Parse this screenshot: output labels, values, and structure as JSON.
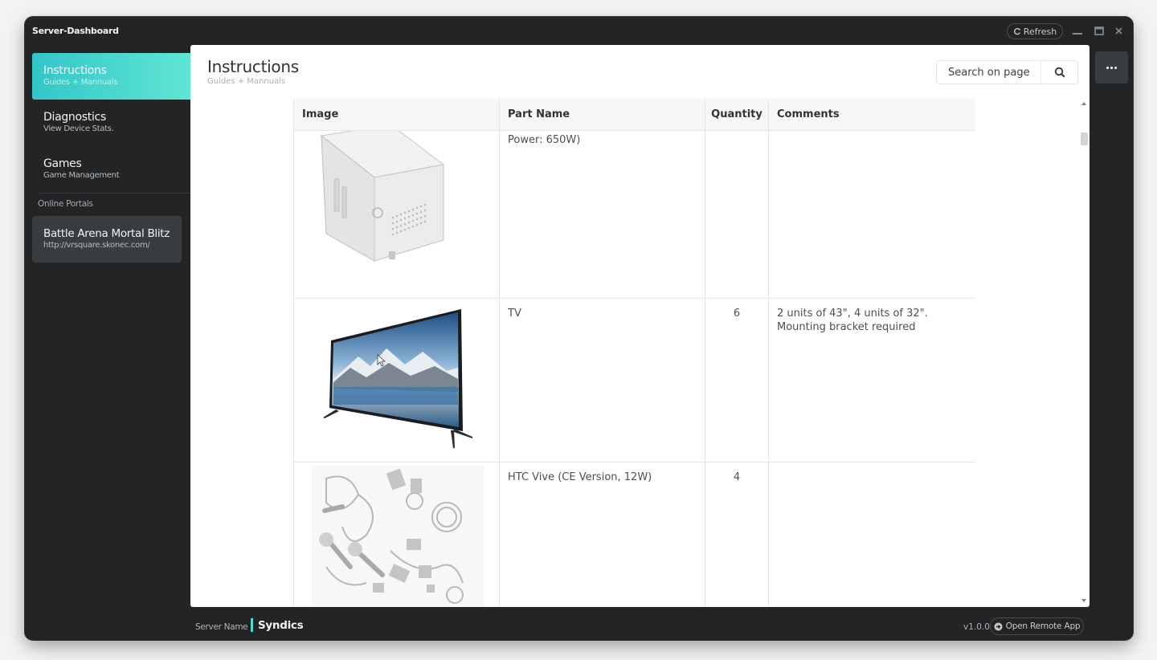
{
  "window": {
    "title": "Server-Dashboard",
    "refresh_label": "Refresh"
  },
  "sidebar": {
    "items": [
      {
        "title": "Instructions",
        "subtitle": "Guides + Mannuals"
      },
      {
        "title": "Diagnostics",
        "subtitle": "View Device Stats."
      },
      {
        "title": "Games",
        "subtitle": "Game Management"
      }
    ],
    "section_label": "Online Portals",
    "portal": {
      "title": "Battle Arena Mortal Blitz",
      "subtitle": "http://vrsquare.skonec.com/"
    }
  },
  "main": {
    "title": "Instructions",
    "subtitle": "Guides + Mannuals",
    "search": {
      "placeholder": "Search on page"
    },
    "table": {
      "columns": [
        "Image",
        "Part Name",
        "Quantity",
        "Comments"
      ],
      "rows": [
        {
          "image": "pc-case-image",
          "part_name": "Power: 650W)",
          "quantity": "",
          "comments": ""
        },
        {
          "image": "tv-image",
          "part_name": "TV",
          "quantity": "6",
          "comments": "2 units of 43\", 4 units of 32\". Mounting bracket required"
        },
        {
          "image": "htc-vive-image",
          "part_name": "HTC Vive (CE Version, 12W)",
          "quantity": "4",
          "comments": ""
        }
      ]
    }
  },
  "footer": {
    "server_label": "Server Name",
    "server_name": "Syndics",
    "version": "v1.0.0",
    "remote_label": "Open Remote App"
  },
  "colors": {
    "accent_start": "#33c6c9",
    "accent_end": "#5fe6d3",
    "window_bg": "#222426"
  }
}
